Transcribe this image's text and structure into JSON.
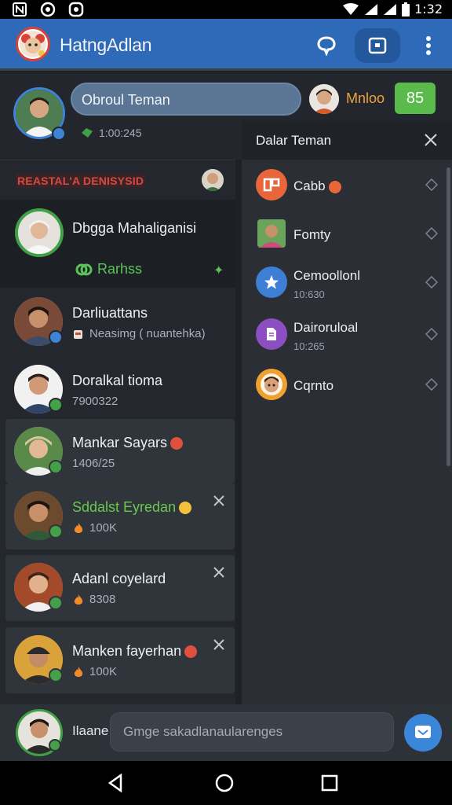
{
  "status_bar": {
    "time": "1:32"
  },
  "app_bar": {
    "title": "HatngAdlan"
  },
  "top_row": {
    "search_text": "Obroul Teman",
    "friend_name": "Mnloo",
    "count_badge": "85",
    "my_status": "1:00:245"
  },
  "left_list": {
    "section_label": "REASTAL'A DENISYSID",
    "featured": {
      "name": "Dbgga Mahaliganisi",
      "action": "Rarhss"
    },
    "items": [
      {
        "name": "Darliuattans",
        "sub": "Neasimg ( nuantehka)",
        "badge": "blue"
      },
      {
        "name": "Doralkal tioma",
        "sub": "7900322",
        "badge": "green"
      },
      {
        "name": "Mankar Sayars",
        "sub": "1406/25",
        "badge": "green"
      },
      {
        "name": "Sddalst Eyredan",
        "sub": "100K",
        "badge": "green"
      },
      {
        "name": "Adanl coyelard",
        "sub": "8308",
        "badge": "green"
      },
      {
        "name": "Manken fayerhan",
        "sub": "100K",
        "badge": "green"
      }
    ]
  },
  "right_panel": {
    "title": "Dalar Teman",
    "items": [
      {
        "name": "Cabb",
        "time": "",
        "icon": "orange-app-icon",
        "color": "#e8663a"
      },
      {
        "name": "Fomty",
        "time": "",
        "icon": "person-photo-icon",
        "color": "#6aa35a"
      },
      {
        "name": "Cemoollonl",
        "time": "10:630",
        "icon": "star-icon",
        "color": "#3e7fd6"
      },
      {
        "name": "Dairoruloal",
        "time": "10:265",
        "icon": "document-icon",
        "color": "#8b4fc2"
      },
      {
        "name": "Cqrnto",
        "time": "",
        "icon": "face-icon",
        "color": "#f0a030"
      }
    ]
  },
  "composer": {
    "name": "Ilaane",
    "placeholder": "Gmge sakadlanaularenges"
  }
}
